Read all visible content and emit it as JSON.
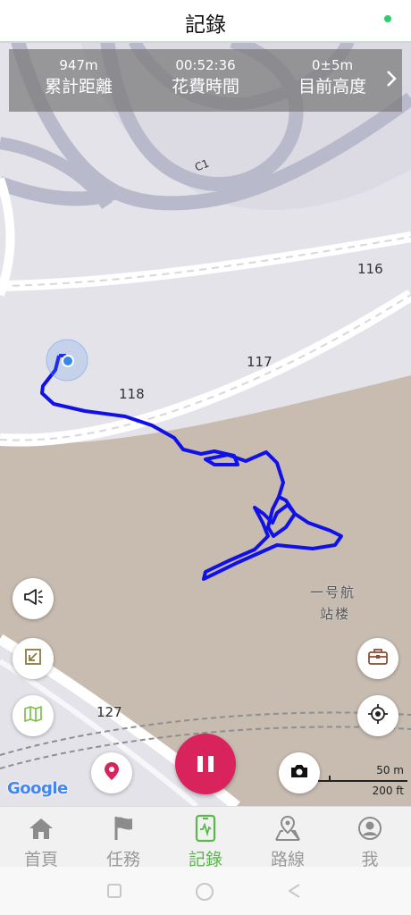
{
  "header": {
    "title": "記錄"
  },
  "stats": {
    "distance_value": "947m",
    "distance_label": "累計距離",
    "time_value": "00:52:36",
    "time_label": "花費時間",
    "altitude_value": "0±5m",
    "altitude_label": "目前高度"
  },
  "map": {
    "labels": {
      "c1": "C1",
      "n116": "116",
      "n117": "117",
      "n118": "118",
      "n127": "127",
      "terminal_line1": "一号航",
      "terminal_line2": "站楼"
    },
    "attribution": "Google",
    "scale_metric": "50 m",
    "scale_imperial": "200 ft",
    "track_color": "#1010e8"
  },
  "nav": {
    "items": [
      {
        "label": "首頁",
        "icon": "home-icon"
      },
      {
        "label": "任務",
        "icon": "flag-icon"
      },
      {
        "label": "記錄",
        "icon": "record-icon"
      },
      {
        "label": "路線",
        "icon": "route-map-icon"
      },
      {
        "label": "我",
        "icon": "profile-icon"
      }
    ],
    "active_index": 2,
    "active_color": "#58b84a"
  }
}
